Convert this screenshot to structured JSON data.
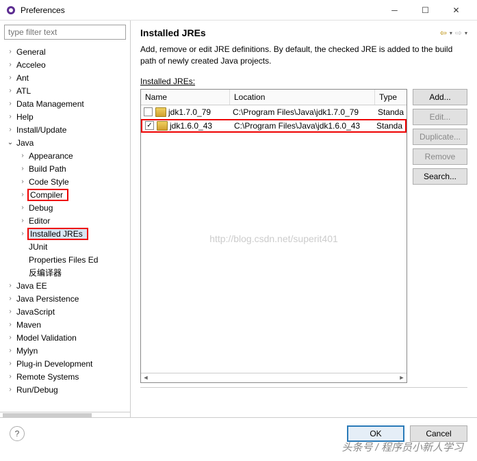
{
  "window": {
    "title": "Preferences"
  },
  "filter": {
    "placeholder": "type filter text"
  },
  "tree": {
    "items": [
      {
        "label": "General",
        "level": 1,
        "arrow": "›"
      },
      {
        "label": "Acceleo",
        "level": 1,
        "arrow": "›"
      },
      {
        "label": "Ant",
        "level": 1,
        "arrow": "›"
      },
      {
        "label": "ATL",
        "level": 1,
        "arrow": "›"
      },
      {
        "label": "Data Management",
        "level": 1,
        "arrow": "›"
      },
      {
        "label": "Help",
        "level": 1,
        "arrow": "›"
      },
      {
        "label": "Install/Update",
        "level": 1,
        "arrow": "›"
      },
      {
        "label": "Java",
        "level": 1,
        "arrow": "⌄",
        "open": true
      },
      {
        "label": "Appearance",
        "level": 2,
        "arrow": "›"
      },
      {
        "label": "Build Path",
        "level": 2,
        "arrow": "›"
      },
      {
        "label": "Code Style",
        "level": 2,
        "arrow": "›"
      },
      {
        "label": "Compiler",
        "level": 2,
        "arrow": "›",
        "highlight": true
      },
      {
        "label": "Debug",
        "level": 2,
        "arrow": "›"
      },
      {
        "label": "Editor",
        "level": 2,
        "arrow": "›"
      },
      {
        "label": "Installed JREs",
        "level": 2,
        "arrow": "›",
        "highlight": true,
        "selected": true
      },
      {
        "label": "JUnit",
        "level": 2,
        "arrow": ""
      },
      {
        "label": "Properties Files Ed",
        "level": 2,
        "arrow": ""
      },
      {
        "label": "反编译器",
        "level": 2,
        "arrow": ""
      },
      {
        "label": "Java EE",
        "level": 1,
        "arrow": "›"
      },
      {
        "label": "Java Persistence",
        "level": 1,
        "arrow": "›"
      },
      {
        "label": "JavaScript",
        "level": 1,
        "arrow": "›"
      },
      {
        "label": "Maven",
        "level": 1,
        "arrow": "›"
      },
      {
        "label": "Model Validation",
        "level": 1,
        "arrow": "›"
      },
      {
        "label": "Mylyn",
        "level": 1,
        "arrow": "›"
      },
      {
        "label": "Plug-in Development",
        "level": 1,
        "arrow": "›"
      },
      {
        "label": "Remote Systems",
        "level": 1,
        "arrow": "›"
      },
      {
        "label": "Run/Debug",
        "level": 1,
        "arrow": "›"
      }
    ]
  },
  "page": {
    "title": "Installed JREs",
    "description": "Add, remove or edit JRE definitions. By default, the checked JRE is added to the build path of newly created Java projects.",
    "list_label": "Installed JREs:",
    "columns": {
      "name": "Name",
      "location": "Location",
      "type": "Type"
    },
    "rows": [
      {
        "checked": true,
        "name": "jdk1.6.0_43",
        "location": "C:\\Program Files\\Java\\jdk1.6.0_43",
        "type": "Standa",
        "highlight": true
      },
      {
        "checked": false,
        "name": "jdk1.7.0_79",
        "location": "C:\\Program Files\\Java\\jdk1.7.0_79",
        "type": "Standa",
        "highlight": false
      }
    ],
    "watermark": "http://blog.csdn.net/superit401"
  },
  "buttons": {
    "add": "Add...",
    "edit": "Edit...",
    "duplicate": "Duplicate...",
    "remove": "Remove",
    "search": "Search..."
  },
  "footer": {
    "ok": "OK",
    "cancel": "Cancel"
  },
  "caption": "头条号 / 程序员小新人学习"
}
